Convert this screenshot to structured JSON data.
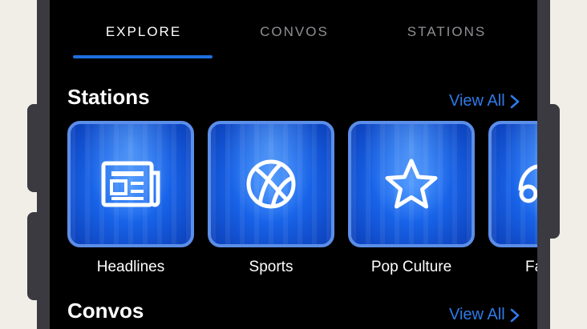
{
  "tabs": [
    {
      "label": "EXPLORE",
      "active": true
    },
    {
      "label": "CONVOS",
      "active": false
    },
    {
      "label": "STATIONS",
      "active": false
    }
  ],
  "stations_section": {
    "title": "Stations",
    "view_all": "View All",
    "cards": [
      {
        "label": "Headlines",
        "icon": "newspaper-icon"
      },
      {
        "label": "Sports",
        "icon": "basketball-icon"
      },
      {
        "label": "Pop Culture",
        "icon": "star-icon"
      },
      {
        "label": "Fa",
        "icon": "partial-icon"
      }
    ]
  },
  "convos_section": {
    "title": "Convos",
    "view_all": "View All"
  },
  "colors": {
    "accent": "#1f6fe0",
    "link": "#2e7ae8",
    "card_blue": "#1863e8",
    "background": "#000000"
  }
}
